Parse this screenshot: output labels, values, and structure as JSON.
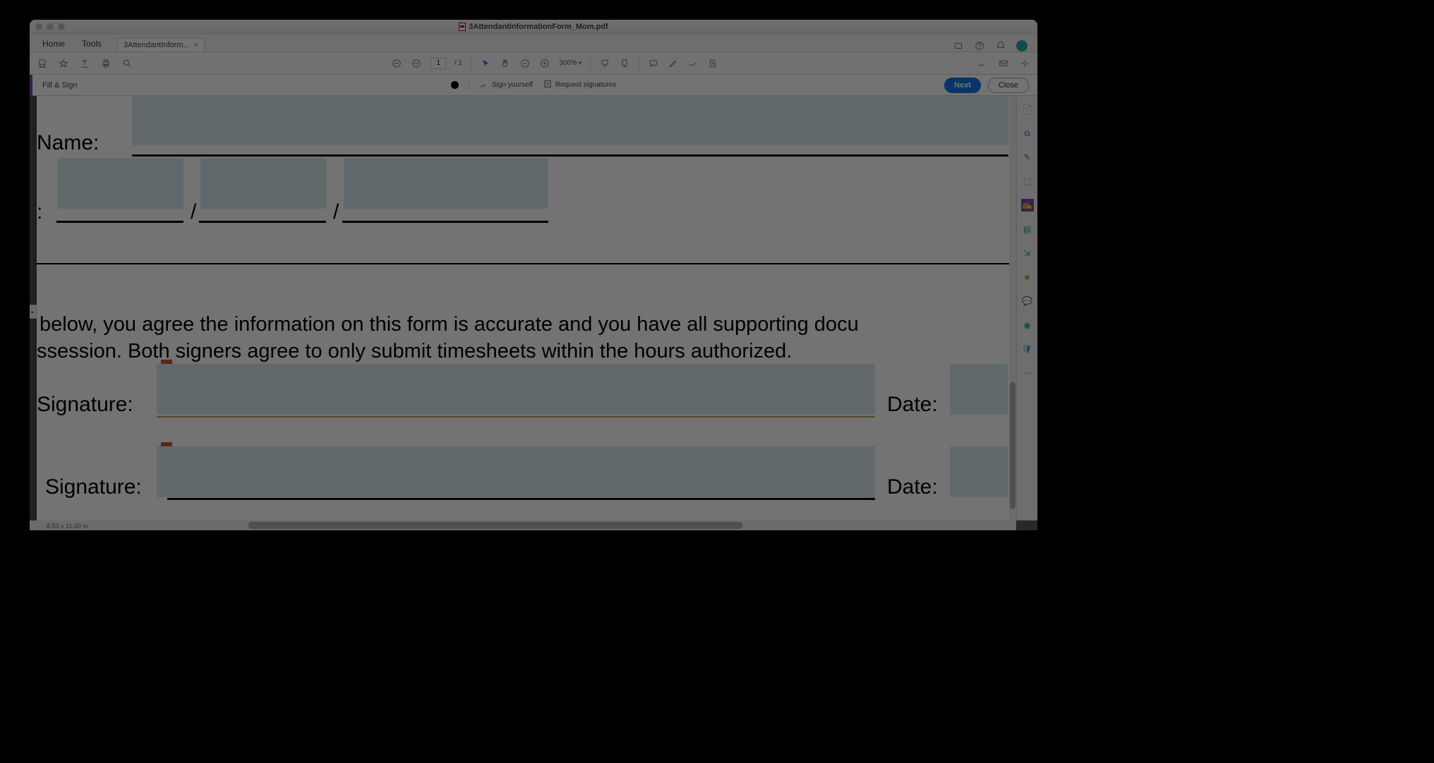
{
  "window": {
    "title": "3AttendantInformationForm_Mom.pdf"
  },
  "tabbar": {
    "home": "Home",
    "tools": "Tools",
    "doc_tab": "3AttendantInform..."
  },
  "toolbar": {
    "page_current": "1",
    "page_total": "/ 1",
    "zoom": "300%"
  },
  "fillsign": {
    "title": "Fill & Sign",
    "sign_yourself": "Sign yourself",
    "request_sigs": "Request signatures",
    "next": "Next",
    "close": "Close"
  },
  "document": {
    "name_label": "Name:",
    "date_sep1": "/",
    "date_sep2": "/",
    "colon": ":",
    "agree_line1": "below, you agree the information on this form is accurate and you have all supporting docu",
    "agree_line2": "ssession. Both signers agree to only submit timesheets within the hours authorized.",
    "signature1": "Signature:",
    "signature2": "Signature:",
    "date1": "Date:",
    "date2": "Date:",
    "page_dims": "8.50 x 11.00 in"
  }
}
